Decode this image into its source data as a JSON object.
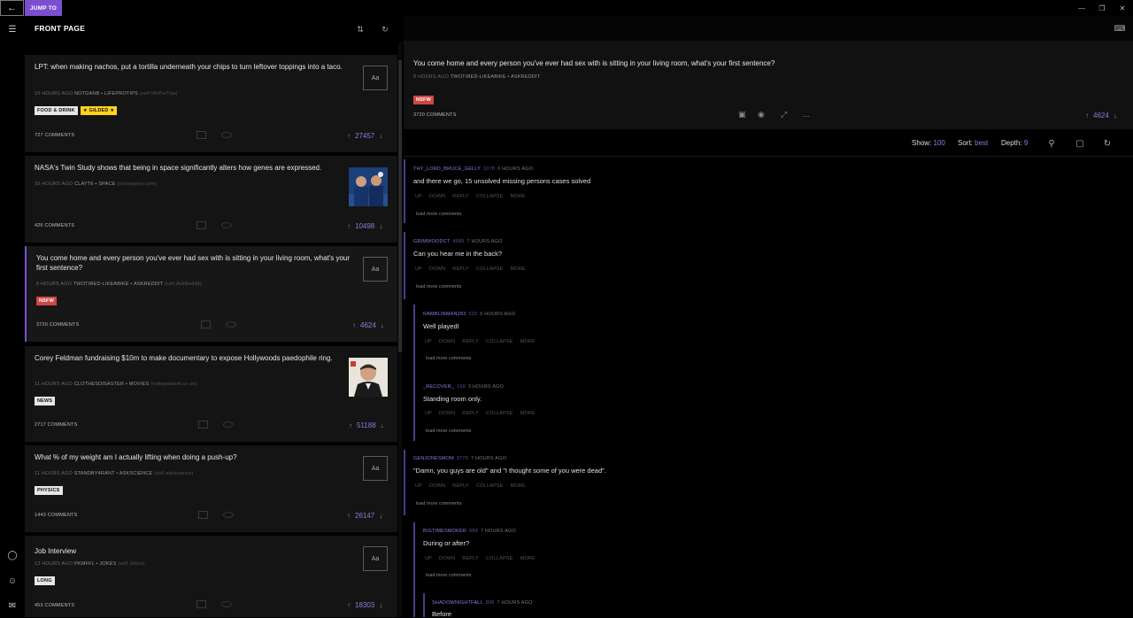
{
  "titlebar": {
    "back_icon": "back-arrow-icon",
    "jump_label": "JUMP TO",
    "controls": [
      "minimize-icon",
      "maximize-icon",
      "close-icon"
    ]
  },
  "rail": {
    "top_icon": "hamburger-menu-icon",
    "bottom_icons": [
      "explore-compass-icon",
      "user-icon",
      "mail-icon"
    ]
  },
  "list": {
    "title": "FRONT PAGE",
    "sort_icon": "sort-icon",
    "refresh_icon": "refresh-icon",
    "posts": [
      {
        "title": "LPT: when making nachos, put a tortilla underneath your chips to turn leftover toppings into a taco.",
        "time": "10 HOURS AGO",
        "author": "NOTDANB",
        "sub": "LIFEPROTIPS",
        "domain": "(self.lifeProTips)",
        "tags": [
          "FOOD & DRINK",
          "★ GILDED ★"
        ],
        "comments": "727 COMMENTS",
        "score": "27457",
        "thumb": "Aa"
      },
      {
        "title": "NASA's Twin Study shows that being in space significantly alters how genes are expressed.",
        "time": "10 HOURS AGO",
        "author": "CLAYT6",
        "sub": "SPACE",
        "domain": "(scitnopeny.com)",
        "tags": [],
        "comments": "426 COMMENTS",
        "score": "10498",
        "thumb": "astronaut-twins-image"
      },
      {
        "title": "You come home and every person you've ever had sex with is sitting in your living room, what's your first sentence?",
        "time": "8 HOURS AGO",
        "author": "TWOTIRED-LIKEABIKE",
        "sub": "ASKREDDIT",
        "domain": "(self.AskReddit)",
        "tags": [
          "NSFW"
        ],
        "comments": "3720 COMMENTS",
        "score": "4624",
        "thumb": "Aa"
      },
      {
        "title": "Corey Feldman fundraising $10m to make documentary to expose Hollywoods paedophile ring.",
        "time": "11 HOURS AGO",
        "author": "CLOTHESDISASTER",
        "sub": "MOVIES",
        "domain": "(independent.co.uk)",
        "tags": [
          "NEWS"
        ],
        "comments": "2717 COMMENTS",
        "score": "51188",
        "thumb": "portrait-image"
      },
      {
        "title": "What % of my weight am I actually lifting when doing a push-up?",
        "time": "11 HOURS AGO",
        "author": "STANDBY4RANT",
        "sub": "ASKSCIENCE",
        "domain": "(self.askscience)",
        "tags": [
          "PHYSICS"
        ],
        "comments": "1443 COMMENTS",
        "score": "26147",
        "thumb": "Aa"
      },
      {
        "title": "Job Interview",
        "time": "13 HOURS AGO",
        "author": "PKMFFL",
        "sub": "JOKES",
        "domain": "(self.Jokes)",
        "tags": [
          "LONG"
        ],
        "comments": "453 COMMENTS",
        "score": "18303",
        "thumb": "Aa"
      }
    ]
  },
  "detail": {
    "settings_icon": "keyboard-icon",
    "title": "You come home and every person you've ever had sex with is sitting in your living room, what's your first sentence?",
    "time": "8 HOURS AGO",
    "author": "TWOTIRED-LIKEABIKE",
    "sub": "ASKREDDIT",
    "tag": "NSFW",
    "comments": "3720 COMMENTS",
    "score": "4624",
    "more": "...",
    "filter": {
      "show_label": "Show:",
      "show_value": "100",
      "sort_label": "Sort:",
      "sort_value": "best",
      "depth_label": "Depth:",
      "depth_value": "9"
    },
    "comment_actions": [
      "UP",
      "DOWN",
      "REPLY",
      "COLLAPSE",
      "MORE"
    ],
    "load_more": "load more comments",
    "comment_list": [
      {
        "user": "THY_LORD_BRUCE_GELLY",
        "score": "1078",
        "time": "6 HOURS AGO",
        "body": "and there we go, 15 unsolved missing persons cases solved"
      },
      {
        "user": "GRIMWOODCT",
        "score": "4685",
        "time": "7 HOURS AGO",
        "body": "Can you hear me in the back?"
      },
      {
        "user": "RAMBLINMAN283",
        "score": "523",
        "time": "6 HOURS AGO",
        "body": "Well played!"
      },
      {
        "user": "_RECOVER_",
        "score": "169",
        "time": "3 HOURS AGO",
        "body": "Standing room only."
      },
      {
        "user": "GENJONESMOM",
        "score": "3773",
        "time": "7 HOURS AGO",
        "body": "\"Damn, you guys are old\" and \"I thought some of you were dead\"."
      },
      {
        "user": "BIGTIMESMOKER",
        "score": "684",
        "time": "7 HOURS AGO",
        "body": "During or after?"
      },
      {
        "user": "SHADOWNIGHTFALL",
        "score": "808",
        "time": "7 HOURS AGO",
        "body": "Before"
      }
    ]
  }
}
